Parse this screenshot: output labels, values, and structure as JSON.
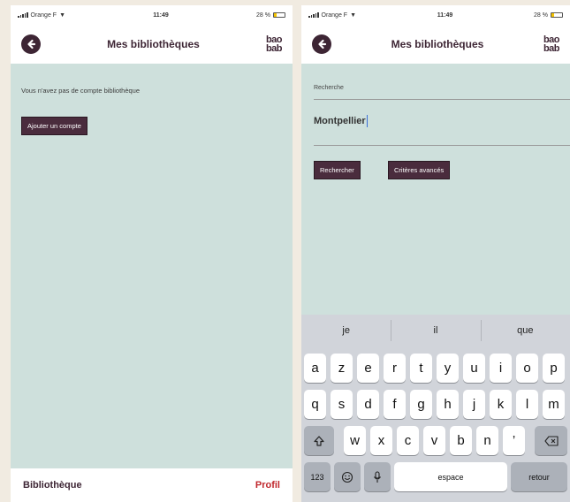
{
  "status": {
    "carrier": "Orange F",
    "time": "11:49",
    "battery": "28 %",
    "battery_level": 0.28
  },
  "left": {
    "nav": {
      "title": "Mes bibliothèques",
      "logo_top": "bao",
      "logo_bottom": "bab"
    },
    "info_text": "Vous n'avez pas de compte bibliothèque",
    "add_account_label": "Ajouter un compte",
    "tabs": {
      "library": "Bibliothèque",
      "profile": "Profil"
    }
  },
  "right": {
    "nav": {
      "title": "Mes bibliothèques",
      "logo_top": "bao",
      "logo_bottom": "bab"
    },
    "search_label": "Recherche",
    "search_value": "Montpellier",
    "search_button": "Rechercher",
    "advanced_button": "Critères avancés",
    "keyboard": {
      "suggestions": [
        "je",
        "il",
        "que"
      ],
      "row1": [
        "a",
        "z",
        "e",
        "r",
        "t",
        "y",
        "u",
        "i",
        "o",
        "p"
      ],
      "row2": [
        "q",
        "s",
        "d",
        "f",
        "g",
        "h",
        "j",
        "k",
        "l",
        "m"
      ],
      "row3": [
        "w",
        "x",
        "c",
        "v",
        "b",
        "n",
        "’"
      ],
      "numbers_key": "123",
      "space_key": "espace",
      "return_key": "retour"
    }
  }
}
